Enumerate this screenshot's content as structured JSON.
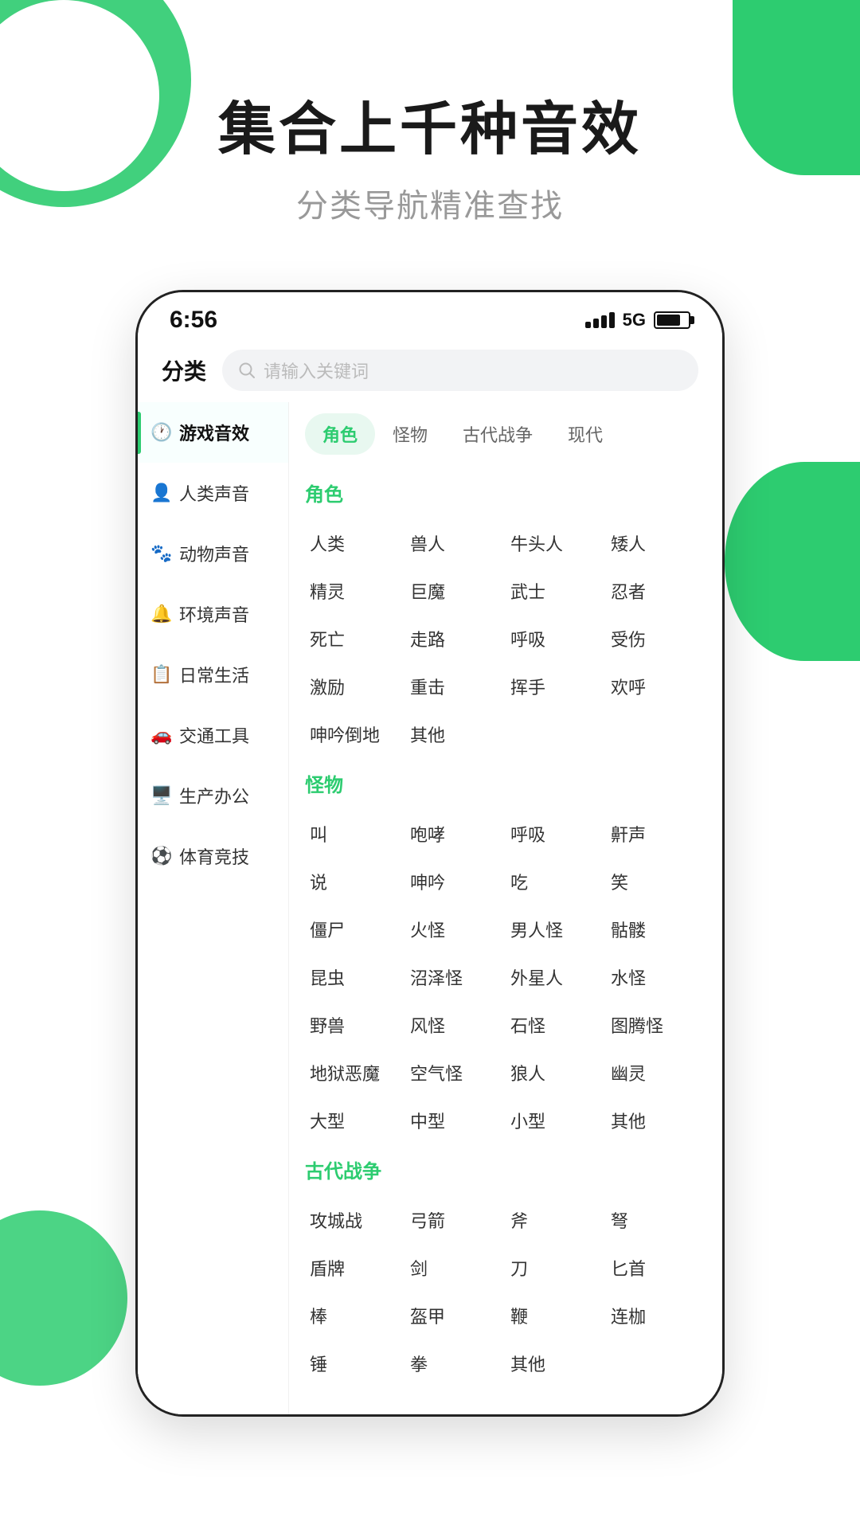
{
  "hero": {
    "title": "集合上千种音效",
    "subtitle": "分类导航精准查找"
  },
  "status_bar": {
    "time": "6:56",
    "network": "5G"
  },
  "search": {
    "label": "分类",
    "placeholder": "请输入关键词"
  },
  "sidebar": {
    "items": [
      {
        "id": "game",
        "label": "游戏音效",
        "icon": "🕐",
        "active": true
      },
      {
        "id": "human",
        "label": "人类声音",
        "icon": "👤",
        "active": false
      },
      {
        "id": "animal",
        "label": "动物声音",
        "icon": "🐾",
        "active": false
      },
      {
        "id": "environment",
        "label": "环境声音",
        "icon": "🔔",
        "active": false
      },
      {
        "id": "daily",
        "label": "日常生活",
        "icon": "📋",
        "active": false
      },
      {
        "id": "transport",
        "label": "交通工具",
        "icon": "🚗",
        "active": false
      },
      {
        "id": "office",
        "label": "生产办公",
        "icon": "🖥️",
        "active": false
      },
      {
        "id": "sports",
        "label": "体育竞技",
        "icon": "⚽",
        "active": false
      }
    ]
  },
  "tabs": [
    {
      "label": "角色",
      "active": true
    },
    {
      "label": "怪物",
      "active": false
    },
    {
      "label": "古代战争",
      "active": false
    },
    {
      "label": "现代",
      "active": false
    }
  ],
  "sections": [
    {
      "title": "角色",
      "color": "green",
      "tags": [
        "人类",
        "兽人",
        "牛头人",
        "矮人",
        "精灵",
        "巨魔",
        "武士",
        "忍者",
        "死亡",
        "走路",
        "呼吸",
        "受伤",
        "激励",
        "重击",
        "挥手",
        "欢呼",
        "呻吟倒地",
        "其他"
      ]
    },
    {
      "title": "怪物",
      "color": "green",
      "tags": [
        "叫",
        "咆哮",
        "呼吸",
        "鼾声",
        "说",
        "呻吟",
        "吃",
        "笑",
        "僵尸",
        "火怪",
        "男人怪",
        "骷髅",
        "昆虫",
        "沼泽怪",
        "外星人",
        "水怪",
        "野兽",
        "风怪",
        "石怪",
        "图腾怪",
        "地狱恶魔",
        "空气怪",
        "狼人",
        "幽灵",
        "大型",
        "中型",
        "小型",
        "其他"
      ]
    },
    {
      "title": "古代战争",
      "color": "green",
      "tags": [
        "攻城战",
        "弓箭",
        "斧",
        "弩",
        "盾牌",
        "剑",
        "刀",
        "匕首",
        "棒",
        "盔甲",
        "鞭",
        "连枷",
        "锤",
        "拳",
        "其他"
      ]
    }
  ]
}
